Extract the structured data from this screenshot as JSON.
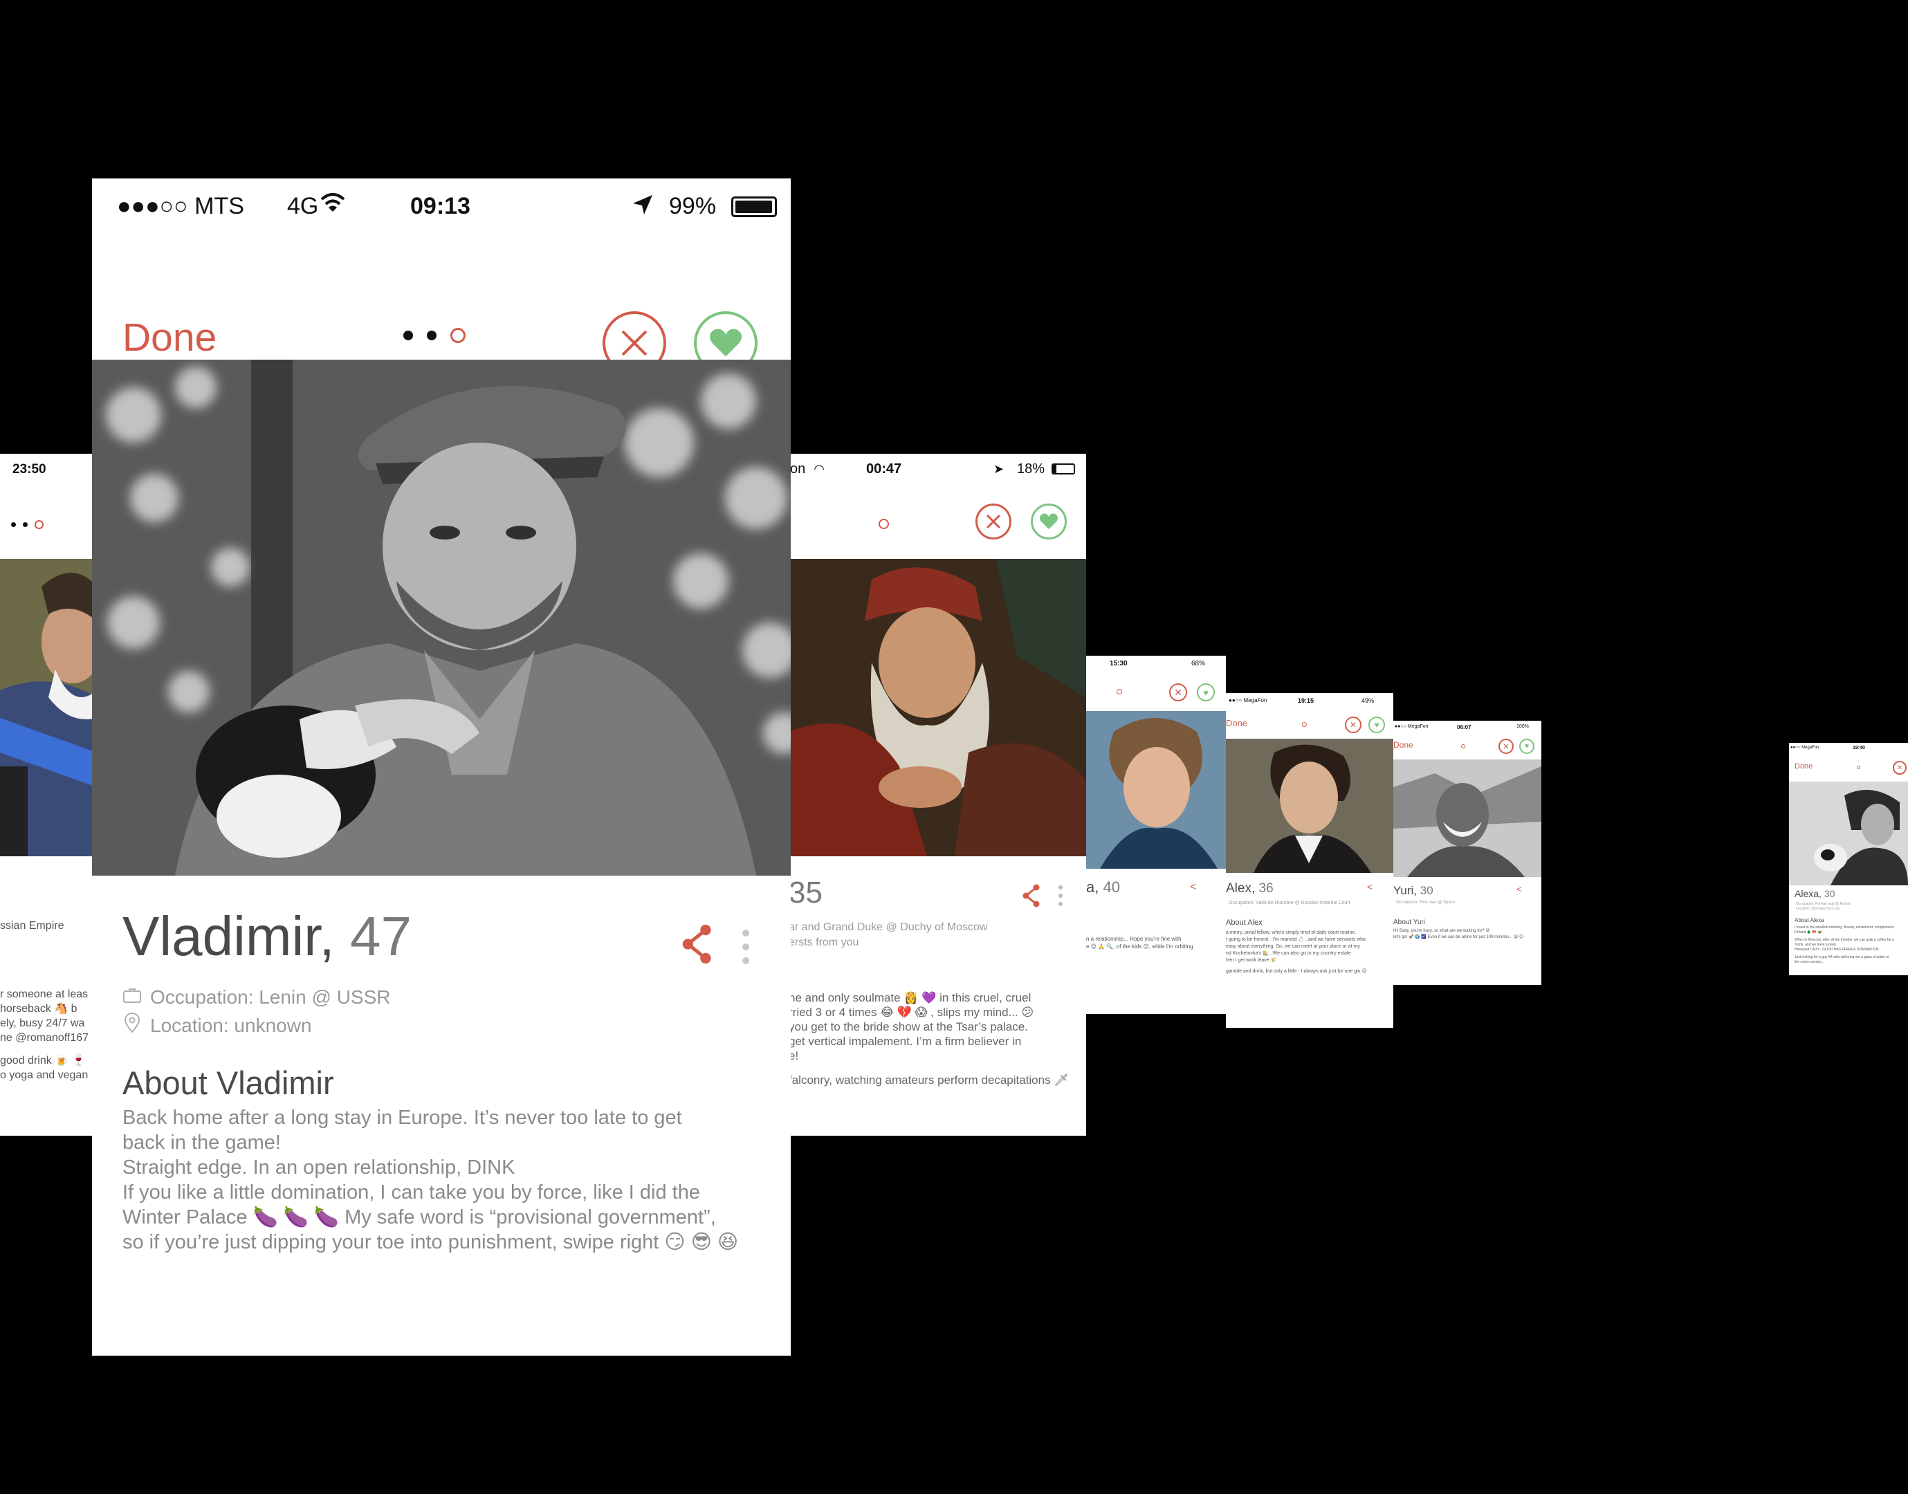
{
  "main": {
    "status": {
      "carrier": "●●●○○ MTS",
      "network": "4G",
      "time": "09:13",
      "battery": "99%"
    },
    "nav": {
      "done_label": "Done",
      "page_index": 2,
      "page_count": 3
    },
    "profile": {
      "name": "Vladimir,",
      "age": "47",
      "occupation": "Occupation: Lenin @ USSR",
      "location": "Location: unknown",
      "about_title": "About Vladimir",
      "about_lines": [
        "Back home after a long stay in Europe. It’s never too late to get",
        "back in the game!",
        "Straight edge. In an open relationship, DINK",
        "If you like a little domination, I can take you by force, like I did the",
        "Winter Palace 🍆 🍆 🍆 My safe word is “provisional government”,",
        "so if you’re just dipping your toe into punishment, swipe right 😏 😎 😆"
      ]
    }
  },
  "left_card": {
    "time": "23:50",
    "lines": [
      "ssian Empire",
      "r someone at leas",
      "horseback 🐴 b",
      "ely, busy 24/7 wa",
      "ne @romanoff167",
      "good drink 🍺 🍷",
      "o yoga and vegan"
    ]
  },
  "right_card": {
    "status_left": "on",
    "time": "00:47",
    "battery": "18%",
    "age": "35",
    "occupation": "ar and Grand Duke @ Duchy of Moscow",
    "location": "ersts from you",
    "lines": [
      "ne and only soulmate 👸 💜 in this cruel, cruel",
      "rried 3 or 4 times 😂 💔 😱 , slips my mind... 😕",
      "you get to the bride show at the Tsar’s palace.",
      "get vertical impalement. I’m a firm believer in",
      "e!",
      "falconry, watching amateurs perform decapitations 🗡"
    ]
  },
  "small_cards": [
    {
      "time": "15:30",
      "battery": "68%",
      "name": "a,",
      "age": "40",
      "lines": [
        "n a relationship... Hope you're fine with",
        "e 😊 🙏 🔍, of the kids 😊, while I'm orbiting"
      ]
    },
    {
      "carrier": "●●○○ MegaFon",
      "time": "19:15",
      "battery": "49%",
      "done": "Done",
      "name": "Alex,",
      "age": "36",
      "occupation": "Occupation: Valet de chambre @ Russian Imperial Court",
      "about": "About Alex",
      "lines": [
        "a merry, jovial fellow, who's simply tired of daily court routine.",
        "t going to be honest - I'm married 💍 , and we have servants who",
        "easy about everything. So, we can meet at your place or at my",
        "nd Kochetovka's 🏡 . We can also go to my country estate",
        "hen I get work leave 🌾",
        "gamble and drink, but only a little - I always ask just for one gin 😉"
      ]
    },
    {
      "carrier": "●●○○ MegaFon",
      "time": "06:07",
      "battery": "100%",
      "done": "Done",
      "name": "Yuri,",
      "age": "30",
      "occupation": "Occupation: First man @ Space",
      "about": "About Yuri",
      "lines": [
        "Hi! Baby, you're busy, so what are we waiting for? 😜",
        "let's go! 🚀 🌍 🌌 Even if we can be alone for just 108 minutes... 😄 😊"
      ]
    },
    {
      "carrier": "●●○○ MegaFon",
      "time": "19:40",
      "done": "Done",
      "name": "Alexa,",
      "age": "30",
      "occupation": "Occupation: Foreign lady @ Russia",
      "location": "Location: 300 miles from you",
      "about": "About Alexa",
      "lines": [
        "I travel to the smallest morning, Beauty, excitement, complement.",
        "Finland 🌲 🎀 🦋",
        "When in Moscow, after all the thunder, we can grab a coffee for a",
        "monk, and we have a peek.",
        "Harassed LADY - GOOD HAS FEMALE DOMINATION",
        "Just looking for a guy 🐶 who will bring me a glass of water ni",
        "the crown armies..."
      ]
    }
  ],
  "colors": {
    "accent": "#d25b4a",
    "like": "#7bc47f",
    "background": "#000000"
  }
}
